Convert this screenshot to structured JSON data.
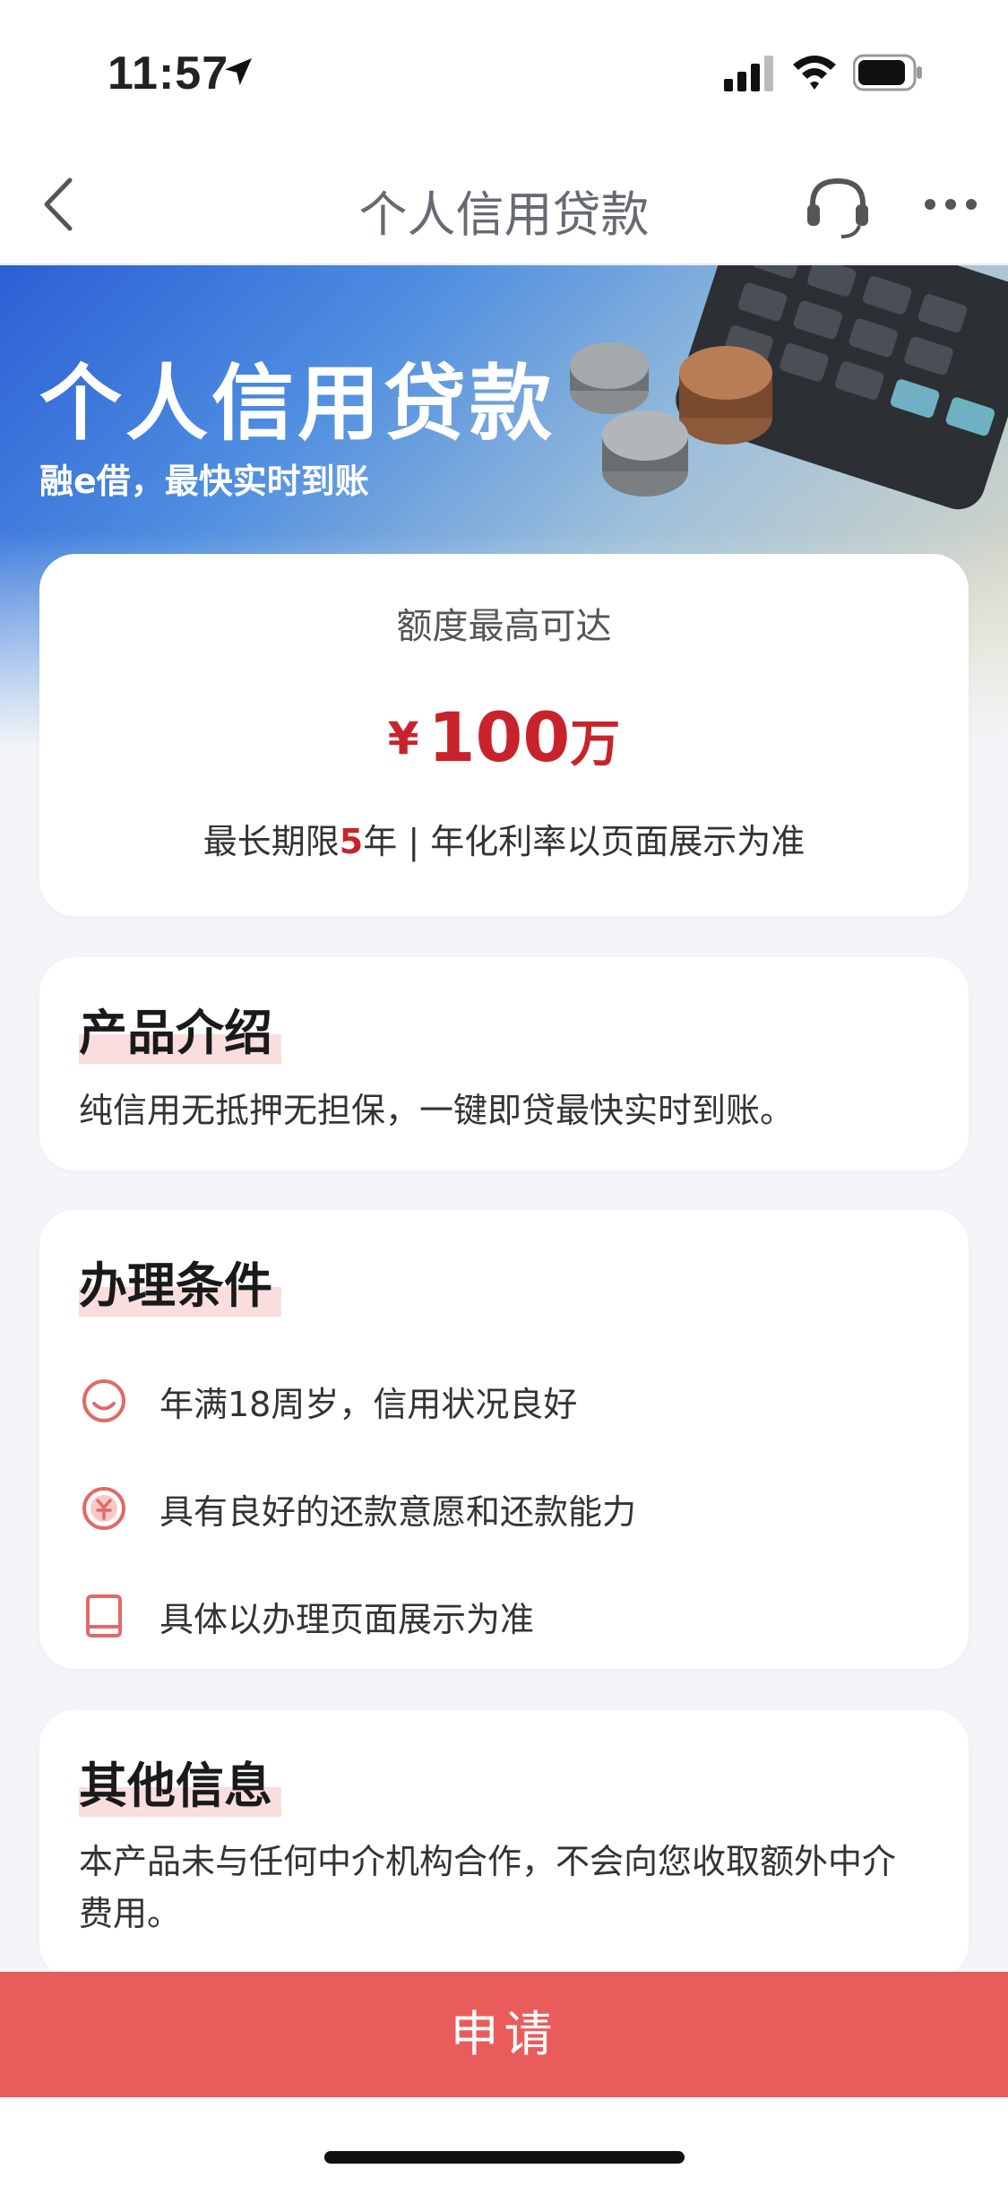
{
  "status_bar": {
    "time": "11:57"
  },
  "nav": {
    "title": "个人信用贷款"
  },
  "banner": {
    "title": "个人信用贷款",
    "subtitle": "融e借，最快实时到账"
  },
  "limit_card": {
    "label": "额度最高可达",
    "currency": "¥",
    "amount": "100",
    "unit": "万",
    "term_prefix": "最长期限",
    "term_value": "5",
    "term_suffix": "年 | 年化利率以页面展示为准"
  },
  "intro": {
    "title": "产品介绍",
    "text": "纯信用无抵押无担保，一键即贷最快实时到账。"
  },
  "conditions": {
    "title": "办理条件",
    "items": [
      {
        "icon": "smile-icon",
        "text": "年满18周岁，信用状况良好"
      },
      {
        "icon": "yuan-coin-icon",
        "text": "具有良好的还款意愿和还款能力"
      },
      {
        "icon": "book-icon",
        "text": "具体以办理页面展示为准"
      }
    ]
  },
  "other": {
    "title": "其他信息",
    "text": "本产品未与任何中介机构合作，不会向您收取额外中介费用。"
  },
  "apply_button": {
    "label": "申请"
  },
  "colors": {
    "accent_red": "#c8232c",
    "button_red": "#e85d5b",
    "banner_blue": "#2b5fd6"
  }
}
